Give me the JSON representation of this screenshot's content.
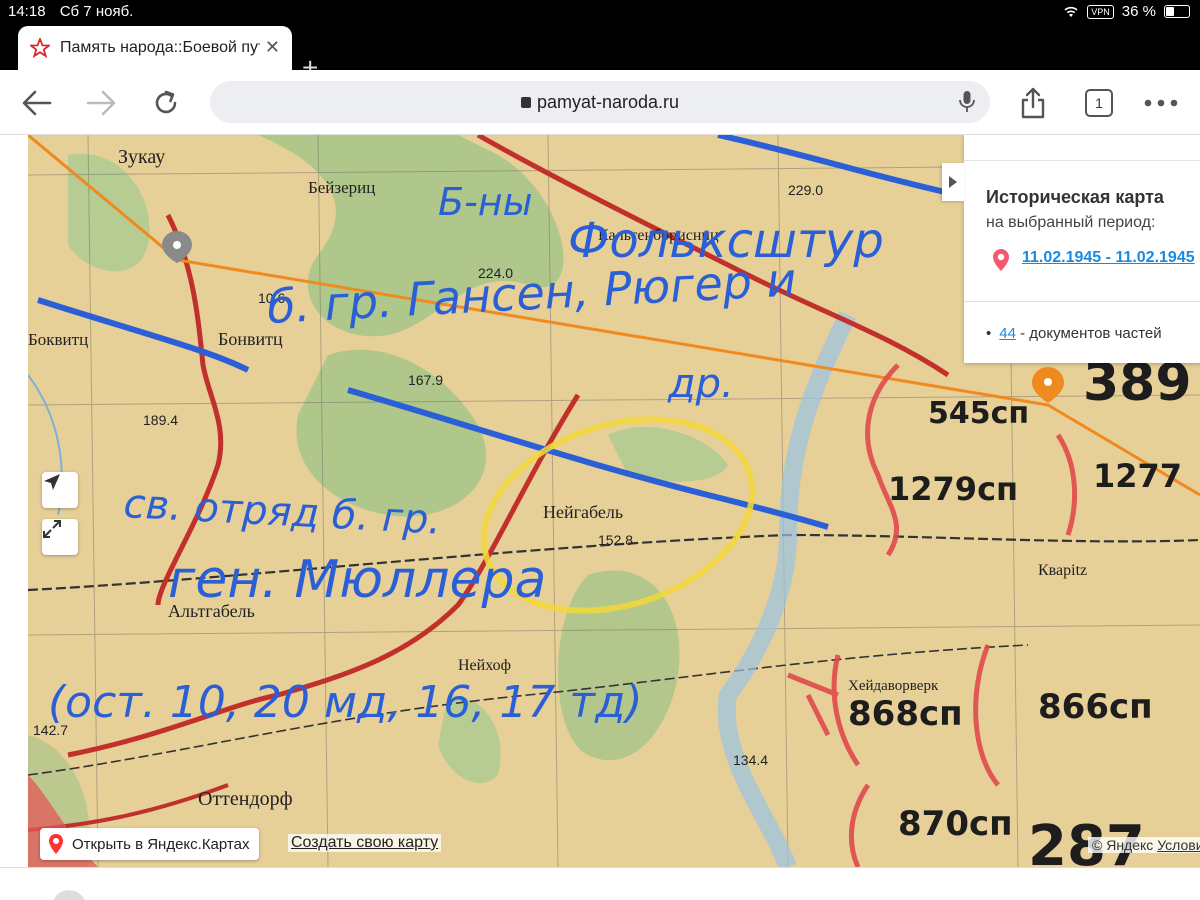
{
  "status": {
    "time": "14:18",
    "date": "Сб 7 нояб.",
    "vpn": "VPN",
    "battery": "36 %"
  },
  "tab": {
    "title": "Память народа::Боевой путь"
  },
  "browser": {
    "url": "pamyat-naroda.ru",
    "tab_count": "1"
  },
  "panel": {
    "heading": "Историческая карта",
    "subheading": "на выбранный период:",
    "period": "11.02.1945 - 11.02.1945",
    "docs_count": "44",
    "docs_text": "- документов частей"
  },
  "map_buttons": {
    "open_yandex": "Открыть в Яндекс.Картах",
    "create_map": "Создать свою карту"
  },
  "copyright": {
    "prefix": "© Яндекс",
    "terms": "Условия"
  },
  "map_labels": {
    "towns": [
      "Зукау",
      "Бейзериц",
      "Боквитц",
      "Бонвитц",
      "Кальтенборисниц",
      "Нейгабель",
      "Альтгабель",
      "Нейхоф",
      "Оттендорф",
      "Кварitz",
      "Хейдаворверк"
    ],
    "heights": [
      "224.0",
      "229.0",
      "167.9",
      "189.4",
      "152.8",
      "134.4",
      "142.7",
      "10.6"
    ],
    "handwriting_blue": [
      "Б-ны",
      "Фольксштур",
      "б. гр. Гансен, Рюгер и",
      "др.",
      "св. отряд б. гр.",
      "ген. Мюллера",
      "(ост. 10, 20 мд, 16, 17 тд)"
    ],
    "units": [
      "545сп",
      "389",
      "1279сп",
      "1277",
      "868сп",
      "866сп",
      "870сп",
      "287"
    ]
  },
  "colors": {
    "map_paper": "#e7cf98",
    "forest": "#a9c58a",
    "blue_ink": "#2b5fd6",
    "red_road": "#c2302b",
    "route": "#ee8a1e",
    "link": "#1a8ae0",
    "highlight": "#f2d83a"
  }
}
